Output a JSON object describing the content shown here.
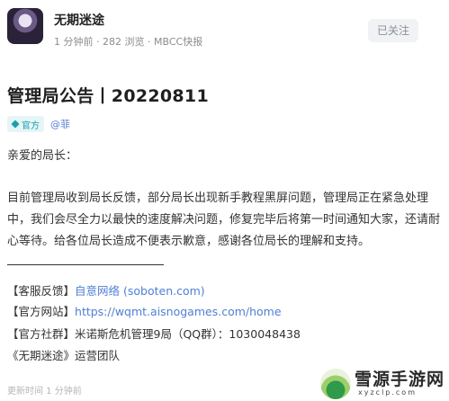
{
  "header": {
    "author": "无期迷途",
    "meta_time": "1 分钟前",
    "meta_views": "282 浏览",
    "meta_source": "MBCC快报",
    "follow_label": "已关注"
  },
  "post": {
    "title": "管理局公告丨20220811",
    "tag_label": "官方",
    "handle": "@菲",
    "greeting": "亲爱的局长：",
    "body": "目前管理局收到局长反馈，部分局长出现新手教程黑屏问题，管理局正在紧急处理中，我们会尽全力以最快的速度解决问题，修复完毕后将第一时间通知大家，还请耐心等待。给各位局长造成不便表示歉意，感谢各位局长的理解和支持。",
    "support_prefix": "【客服反馈】",
    "support_link": "自意网络 (soboten.com)",
    "site_prefix": "【官方网站】",
    "site_link": "https://wqmt.aisnogames.com/home",
    "community_prefix": "【官方社群】",
    "community_text": "米诺斯危机管理9局（QQ群）：1030048438",
    "signature": "《无期迷途》运营团队",
    "edit_time": "更新时间 1 分钟前"
  },
  "watermark": {
    "title": "雪源手游网",
    "url": "xyzclp.com"
  },
  "colors": {
    "accent_tag": "#19a1ad",
    "link": "#4f7fd6"
  },
  "icons": {
    "avatar": "author-avatar",
    "tag": "official-gem-icon",
    "watermark": "watermark-logo"
  }
}
